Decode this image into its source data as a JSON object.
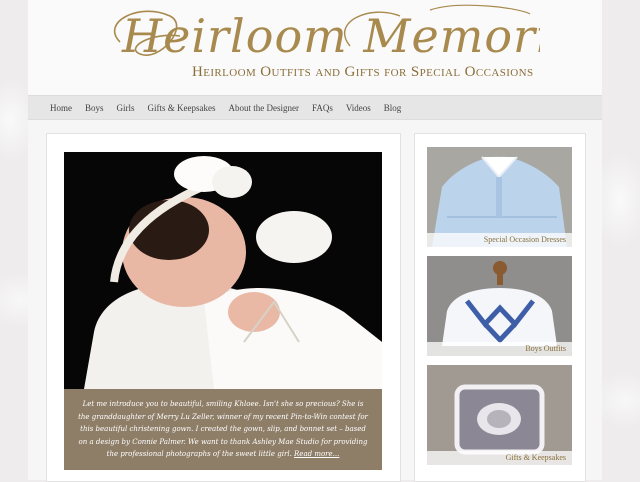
{
  "header": {
    "logo_text": "Heirloom Memories",
    "tagline": "Heirloom Outfits and Gifts for Special Occasions"
  },
  "nav": {
    "items": [
      "Home",
      "Boys",
      "Girls",
      "Gifts & Keepsakes",
      "About the Designer",
      "FAQs",
      "Videos",
      "Blog"
    ]
  },
  "feature": {
    "caption": "Let me introduce you to beautiful, smiling Khloee. Isn't she so precious? She is the granddaughter of Merry Lu Zeller, winner of my recent Pin-to-Win contest for this beautiful christening gown. I created the gown, slip, and bonnet set – based on a design by Connie Palmer. We want to thank Ashley Mae Studio for providing the professional photographs of the sweet little girl.",
    "read_more": "Read more..."
  },
  "categories": [
    {
      "label": "Special Occasion Dresses"
    },
    {
      "label": "Boys Outfits"
    },
    {
      "label": "Gifts & Keepsakes"
    }
  ],
  "colors": {
    "brand_gold": "#a88a4e",
    "caption_bg": "#8e7e68",
    "nav_bg": "#e6e6e6"
  }
}
